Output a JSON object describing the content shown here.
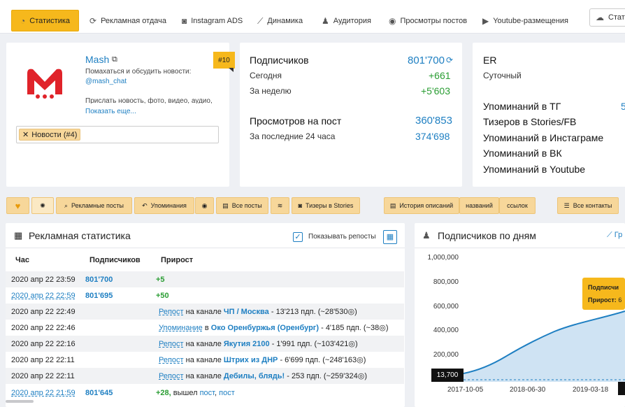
{
  "nav": {
    "items": [
      {
        "label": "Статистика",
        "icon": "chart-icon"
      },
      {
        "label": "Рекламная отдача",
        "icon": "refresh-icon"
      },
      {
        "label": "Instagram ADS",
        "icon": "instagram-icon"
      },
      {
        "label": "Динамика",
        "icon": "line-chart-icon"
      },
      {
        "label": "Аудитория",
        "icon": "users-icon"
      },
      {
        "label": "Просмотры постов",
        "icon": "eye-icon"
      },
      {
        "label": "Youtube-размещения",
        "icon": "youtube-icon"
      },
      {
        "label": "Стати",
        "icon": "cloud-icon"
      }
    ]
  },
  "channel": {
    "name": "Mash",
    "rank": "#10",
    "desc": "Помахаться и обсудить новости:",
    "handle": "@mash_chat",
    "desc2": "Прислать новость, фото, видео, аудио,",
    "more": "Показать еще...",
    "tag": "Новости (#4)"
  },
  "subs": {
    "label": "Подписчиков",
    "value": "801'700",
    "today_label": "Сегодня",
    "today": "+661",
    "week_label": "За неделю",
    "week": "+5'603",
    "views_label": "Просмотров на пост",
    "views": "360'853",
    "last24_label": "За последние 24 часа",
    "last24": "374'698"
  },
  "er": {
    "title": "ER",
    "daily": "Суточный",
    "m_tg": "Упоминаний в ТГ",
    "m_tg_val": "5",
    "teasers": "Тизеров в Stories/FB",
    "m_ig": "Упоминаний в Инстаграме",
    "m_vk": "Упоминаний в ВК",
    "m_yt": "Упоминаний в Youtube"
  },
  "actions": {
    "ads": "Рекламные посты",
    "mentions": "Упоминания",
    "all_posts": "Все посты",
    "teasers": "Тизеры в Stories",
    "history": "История описаний",
    "names": "названий",
    "links": "ссылок",
    "contacts": "Все контакты"
  },
  "ad_stats": {
    "title": "Рекламная статистика",
    "show_reposts": "Показывать репосты",
    "columns": [
      "Час",
      "Подписчиков",
      "Прирост"
    ],
    "rows": [
      {
        "time": "2020 апр 22 23:59",
        "subs": "801'700",
        "growth": "+5",
        "link": false
      },
      {
        "time": "2020 апр 22 22:59",
        "subs": "801'695",
        "growth": "+50",
        "link": true
      },
      {
        "time": "2020 апр 22 22:49",
        "kind": "Репост",
        "prep": "на канале",
        "channel": "ЧП / Москва",
        "info": "- 13'213 пдп. (~28'530"
      },
      {
        "time": "2020 апр 22 22:46",
        "kind": "Упоминание",
        "prep": "в",
        "channel": "Око Оренбуржья (Оренбург)",
        "info": "- 4'185 пдп. (~38"
      },
      {
        "time": "2020 апр 22 22:16",
        "kind": "Репост",
        "prep": "на канале",
        "channel": "Якутия 2100",
        "info": "- 1'991 пдп. (~103'421"
      },
      {
        "time": "2020 апр 22 22:11",
        "kind": "Репост",
        "prep": "на канале",
        "channel": "Штрих из ДНР",
        "info": "- 6'699 пдп. (~248'163"
      },
      {
        "time": "2020 апр 22 22:11",
        "kind": "Репост",
        "prep": "на канале",
        "channel": "Дебилы, блядь!",
        "info": "- 253 пдп. (~259'324"
      },
      {
        "time": "2020 апр 22 21:59",
        "subs": "801'645",
        "growth": "+28,",
        "tail": "вышел",
        "tail_a": "пост",
        "tail_b": "пост",
        "link": true
      }
    ]
  },
  "subs_chart": {
    "title": "Подписчиков по дням",
    "tab": "Гр",
    "tooltip_label1": "Подписчи",
    "tooltip_label2": "Прирост:",
    "tooltip_val": "6",
    "start_label": "13,700",
    "y_ticks": [
      "1,000,000",
      "800,000",
      "600,000",
      "400,000",
      "200,000"
    ],
    "x_ticks": [
      "2017-10-05",
      "2018-06-30",
      "2019-03-18"
    ]
  },
  "chart_data": {
    "type": "area",
    "title": "Подписчиков по дням",
    "x": [
      "2017-10-05",
      "2018-06-30",
      "2019-03-18"
    ],
    "series": [
      {
        "values": [
          13700,
          330000,
          620000
        ]
      }
    ],
    "ylim": [
      0,
      1000000
    ],
    "color": "#1e7fc2"
  }
}
